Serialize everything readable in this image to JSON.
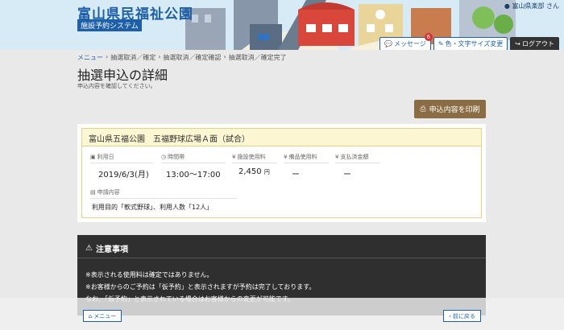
{
  "header": {
    "site_title": "富山県民福祉公園",
    "site_subtitle": "施設予約システム",
    "user_name": "富山県楽部 さん",
    "buttons": {
      "message": "メッセージ",
      "message_count": "6",
      "color_size": "色・文字サイズ変更",
      "logout": "ログアウト"
    }
  },
  "breadcrumb": [
    "メニュー",
    "抽選取消／確定",
    "抽選取消／確定確認",
    "抽選取消／確定完了"
  ],
  "page": {
    "title": "抽選申込の詳細",
    "description": "申込内容を確認してください。"
  },
  "print_label": "申込内容を印刷",
  "detail": {
    "facility": "富山県五福公園",
    "room": "五福野球広場Ａ面（試合）",
    "labels": {
      "date": "利用日",
      "time": "時間帯",
      "facility_fee": "施設使用料",
      "equipment_fee": "備品使用料",
      "payment": "支払済金額",
      "content": "申請内容"
    },
    "values": {
      "date": "2019/6/3(月)",
      "time": "13:00〜17:00",
      "facility_fee": "2,450",
      "fee_unit": "円",
      "equipment_fee": "ー",
      "payment": "ー",
      "content": "利用目的「軟式野球」、利用人数「12人」"
    }
  },
  "notes": {
    "title": "注意事項",
    "lines": [
      "※表示される使用料は確定ではありません。",
      "※お客様からのご予約は「仮予約」と表示されますが予約は完了しております。",
      "なお、「仮予約」と表示されている場合はお客様からの変更が可能です。"
    ]
  },
  "footer": {
    "menu": "メニュー",
    "back": "前に戻る"
  },
  "colors": {
    "brand_blue": "#1d5fa8",
    "print_brown": "#8b6d45",
    "card_head": "#fdf6d2"
  }
}
